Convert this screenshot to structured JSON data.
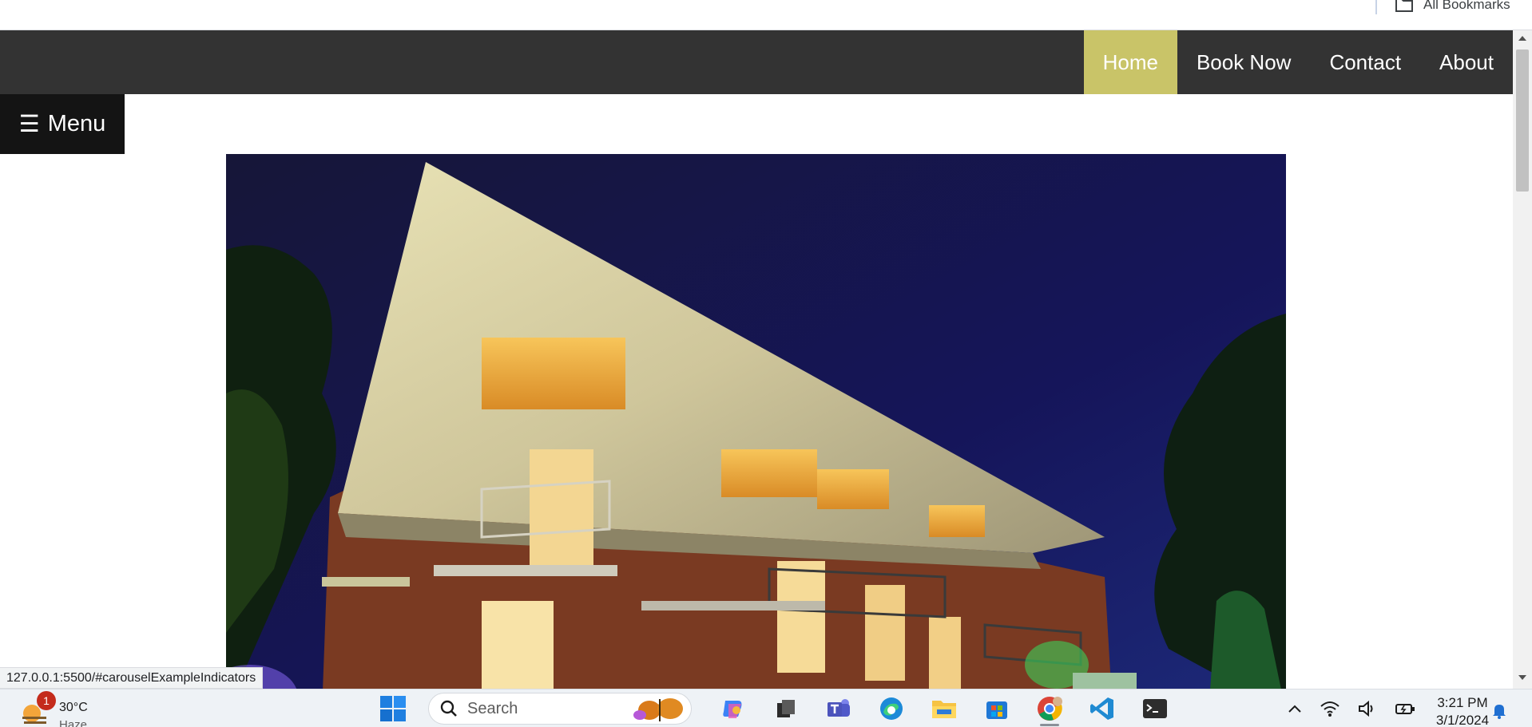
{
  "bookmarks": {
    "all_bookmarks_label": "All Bookmarks",
    "folder_icon": "folder-icon"
  },
  "navbar": {
    "links": [
      {
        "label": "Home",
        "active": true
      },
      {
        "label": "Book Now",
        "active": false
      },
      {
        "label": "Contact",
        "active": false
      },
      {
        "label": "About",
        "active": false
      }
    ],
    "background": "#333333",
    "active_color": "#c9c468"
  },
  "menu_button": {
    "icon": "hamburger-icon",
    "glyph": "☰",
    "label": "Menu"
  },
  "carousel": {
    "image": "building-night-photo"
  },
  "status_bar": {
    "url": "127.0.0.1:5500/#carouselExampleIndicators"
  },
  "taskbar": {
    "weather": {
      "badge": "1",
      "temperature": "30°C",
      "condition": "Haze"
    },
    "search_placeholder": "Search",
    "apps": [
      "windows-start",
      "search",
      "copilot",
      "task-view",
      "teams",
      "edge",
      "file-explorer",
      "microsoft-store",
      "chrome",
      "vs-code",
      "terminal"
    ],
    "clock": {
      "time": "3:21 PM",
      "date": "3/1/2024"
    }
  }
}
